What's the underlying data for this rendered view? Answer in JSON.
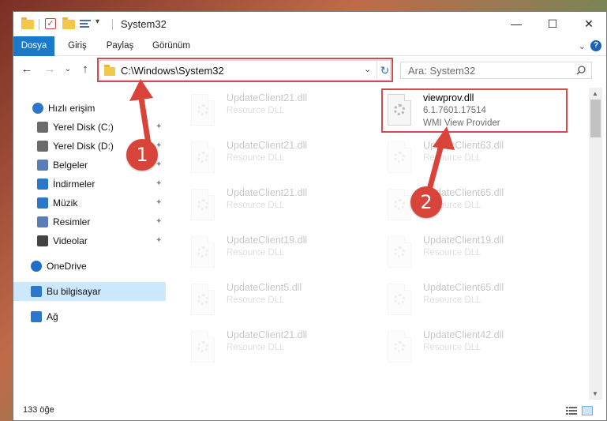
{
  "window": {
    "title": "System32",
    "minimize": "—",
    "maximize": "☐",
    "close": "✕"
  },
  "ribbon": {
    "tabs": [
      "Dosya",
      "Giriş",
      "Paylaş",
      "Görünüm"
    ],
    "expand": "⌄",
    "help": "?"
  },
  "address": {
    "path": "C:\\Windows\\System32",
    "dropdown": "⌄",
    "refresh": "↻"
  },
  "search": {
    "placeholder": "Ara: System32"
  },
  "nav_buttons": {
    "back": "←",
    "forward": "→",
    "recent": "⌄",
    "up": "↑"
  },
  "sidebar": {
    "items": [
      {
        "label": "Hızlı erişim",
        "icon": "star-icon",
        "pinned": false
      },
      {
        "label": "Yerel Disk (C:)",
        "icon": "drive-icon",
        "pinned": true
      },
      {
        "label": "Yerel Disk (D:)",
        "icon": "drive-icon",
        "pinned": true
      },
      {
        "label": "Belgeler",
        "icon": "documents-icon",
        "pinned": true
      },
      {
        "label": "İndirmeler",
        "icon": "download-icon",
        "pinned": true
      },
      {
        "label": "Müzik",
        "icon": "music-icon",
        "pinned": true
      },
      {
        "label": "Resimler",
        "icon": "pictures-icon",
        "pinned": true
      },
      {
        "label": "Videolar",
        "icon": "video-icon",
        "pinned": true
      },
      {
        "label": "OneDrive",
        "icon": "cloud-icon",
        "pinned": false
      },
      {
        "label": "Bu bilgisayar",
        "icon": "computer-icon",
        "pinned": false,
        "selected": true
      },
      {
        "label": "Ağ",
        "icon": "network-icon",
        "pinned": false
      }
    ],
    "pin_glyph": "📌"
  },
  "files": [
    {
      "name": "UpdateClient21.dll",
      "sub": "Resource DLL",
      "faded": true
    },
    {
      "name": "viewprov.dll",
      "version": "6.1.7601.17514",
      "desc": "WMI View Provider",
      "faded": false
    },
    {
      "name": "UpdateClient21.dll",
      "sub": "Resource DLL",
      "faded": true
    },
    {
      "name": "UpdateClient63.dll",
      "sub": "Resource DLL",
      "faded": true
    },
    {
      "name": "UpdateClient21.dll",
      "sub": "Resource DLL",
      "faded": true
    },
    {
      "name": "UpdateClient65.dll",
      "sub": "Resource DLL",
      "faded": true
    },
    {
      "name": "UpdateClient19.dll",
      "sub": "Resource DLL",
      "faded": true
    },
    {
      "name": "UpdateClient19.dll",
      "sub": "Resource DLL",
      "faded": true
    },
    {
      "name": "UpdateClient5.dll",
      "sub": "Resource DLL",
      "faded": true
    },
    {
      "name": "UpdateClient65.dll",
      "sub": "Resource DLL",
      "faded": true
    },
    {
      "name": "UpdateClient21.dll",
      "sub": "Resource DLL",
      "faded": true
    },
    {
      "name": "UpdateClient42.dll",
      "sub": "Resource DLL",
      "faded": true
    }
  ],
  "status": {
    "count": "133 öğe"
  },
  "annotations": {
    "step1": "1",
    "step2": "2",
    "color": "#d9443a"
  }
}
